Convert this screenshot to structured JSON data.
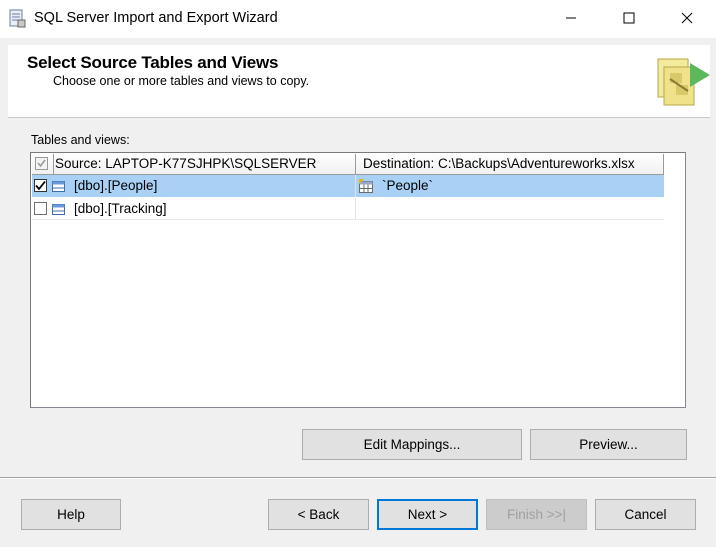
{
  "window": {
    "title": "SQL Server Import and Export Wizard"
  },
  "header": {
    "title": "Select Source Tables and Views",
    "subtitle": "Choose one or more tables and views to copy."
  },
  "tables": {
    "label": "Tables and views:",
    "columns": {
      "source": "Source: LAPTOP-K77SJHPK\\SQLSERVER",
      "destination": "Destination: C:\\Backups\\Adventureworks.xlsx"
    },
    "rows": [
      {
        "source": "[dbo].[People]",
        "destination": "`People`",
        "checked": true,
        "selected": true
      },
      {
        "source": "[dbo].[Tracking]",
        "destination": "",
        "checked": false,
        "selected": false
      }
    ]
  },
  "buttons": {
    "edit_mappings": "Edit Mappings...",
    "preview": "Preview...",
    "help": "Help",
    "back": "< Back",
    "next": "Next >",
    "finish": "Finish >>|",
    "cancel": "Cancel"
  },
  "icons": {
    "app": "wizard-app-icon",
    "header": "data-transfer-graphic",
    "table": "table-icon",
    "destination": "sheet-icon"
  },
  "colors": {
    "selection": "#a9d1f5",
    "default_button_border": "#0078d7",
    "disabled_text": "#a0a0a0"
  }
}
